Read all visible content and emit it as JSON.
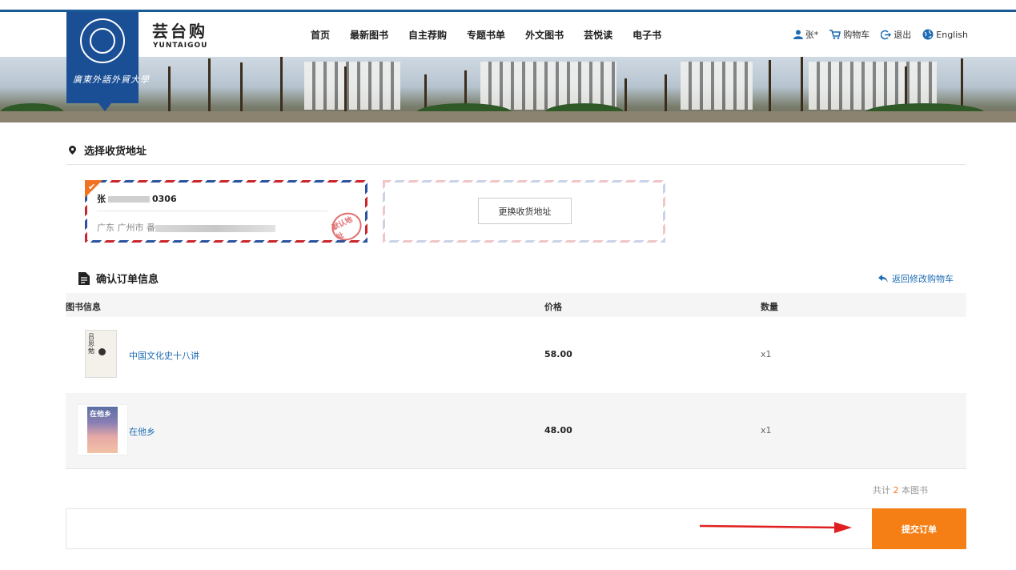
{
  "brand": {
    "title": "芸台购",
    "subtitle": "YUNTAIGOU"
  },
  "logo": {
    "text": "廣東外語外貿大學"
  },
  "nav": [
    "首页",
    "最新图书",
    "自主荐购",
    "专题书单",
    "外文图书",
    "芸悦读",
    "电子书"
  ],
  "user_bar": {
    "user": "张*",
    "cart": "购物车",
    "logout": "退出",
    "language": "English"
  },
  "address_section": {
    "title": "选择收货地址",
    "selected": {
      "name_prefix": "张",
      "phone_suffix": "0306",
      "address_prefix": "广东 广州市 番",
      "stamp": "默认地址"
    },
    "change_button": "更换收货地址"
  },
  "order_section": {
    "title": "确认订单信息",
    "back_link": "返回修改购物车",
    "columns": {
      "book": "图书信息",
      "price": "价格",
      "qty": "数量"
    },
    "rows": [
      {
        "title": "中国文化史十八讲",
        "price": "58.00",
        "qty": "x1",
        "cover_text": "吕思勉"
      },
      {
        "title": "在他乡",
        "price": "48.00",
        "qty": "x1",
        "cover_text": "在他乡"
      }
    ]
  },
  "summary": {
    "prefix": "共计 ",
    "count": "2",
    "suffix": " 本图书"
  },
  "submit_button": "提交订单",
  "colors": {
    "accent": "#f57f14",
    "brand": "#1b4f95",
    "link": "#1f6cb3"
  }
}
